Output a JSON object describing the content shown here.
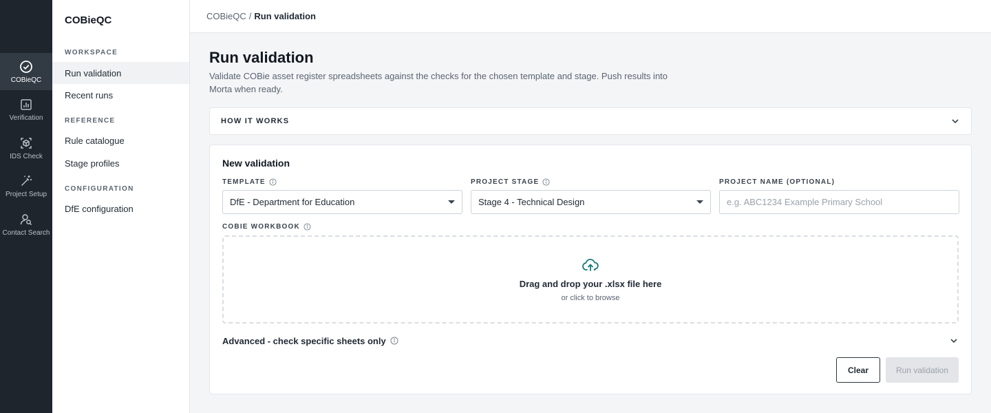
{
  "rail": {
    "items": [
      {
        "label": "COBieQC",
        "icon": "check-circle-icon",
        "active": true
      },
      {
        "label": "Verification",
        "icon": "bar-chart-icon"
      },
      {
        "label": "IDS Check",
        "icon": "scan-cube-icon"
      },
      {
        "label": "Project Setup",
        "icon": "magic-wand-icon"
      },
      {
        "label": "Contact Search",
        "icon": "user-search-icon"
      }
    ]
  },
  "subnav": {
    "title": "COBieQC",
    "sections": [
      {
        "heading": "WORKSPACE",
        "items": [
          "Run validation",
          "Recent runs"
        ]
      },
      {
        "heading": "REFERENCE",
        "items": [
          "Rule catalogue",
          "Stage profiles"
        ]
      },
      {
        "heading": "CONFIGURATION",
        "items": [
          "DfE configuration"
        ]
      }
    ],
    "active_item": "Run validation"
  },
  "breadcrumb": {
    "root": "COBieQC",
    "separator": "/",
    "current": "Run validation"
  },
  "page": {
    "title": "Run validation",
    "description": "Validate COBie asset register spreadsheets against the checks for the chosen template and stage. Push results into Morta when ready."
  },
  "how_it_works": {
    "label": "HOW IT WORKS"
  },
  "form": {
    "title": "New validation",
    "template": {
      "label": "TEMPLATE",
      "value": "DfE - Department for Education"
    },
    "project_stage": {
      "label": "PROJECT STAGE",
      "value": "Stage 4 - Technical Design"
    },
    "project_name": {
      "label": "PROJECT NAME (OPTIONAL)",
      "value": "",
      "placeholder": "e.g. ABC1234 Example Primary School"
    },
    "workbook": {
      "label": "COBIE WORKBOOK",
      "drop_text": "Drag and drop your .xlsx file here",
      "browse_text": "or click to browse"
    },
    "advanced_label": "Advanced - check specific sheets only",
    "clear_label": "Clear",
    "run_label": "Run validation"
  },
  "colors": {
    "rail_bg": "#1f252d",
    "accent_teal": "#127a78",
    "page_bg": "#f4f5f7"
  }
}
